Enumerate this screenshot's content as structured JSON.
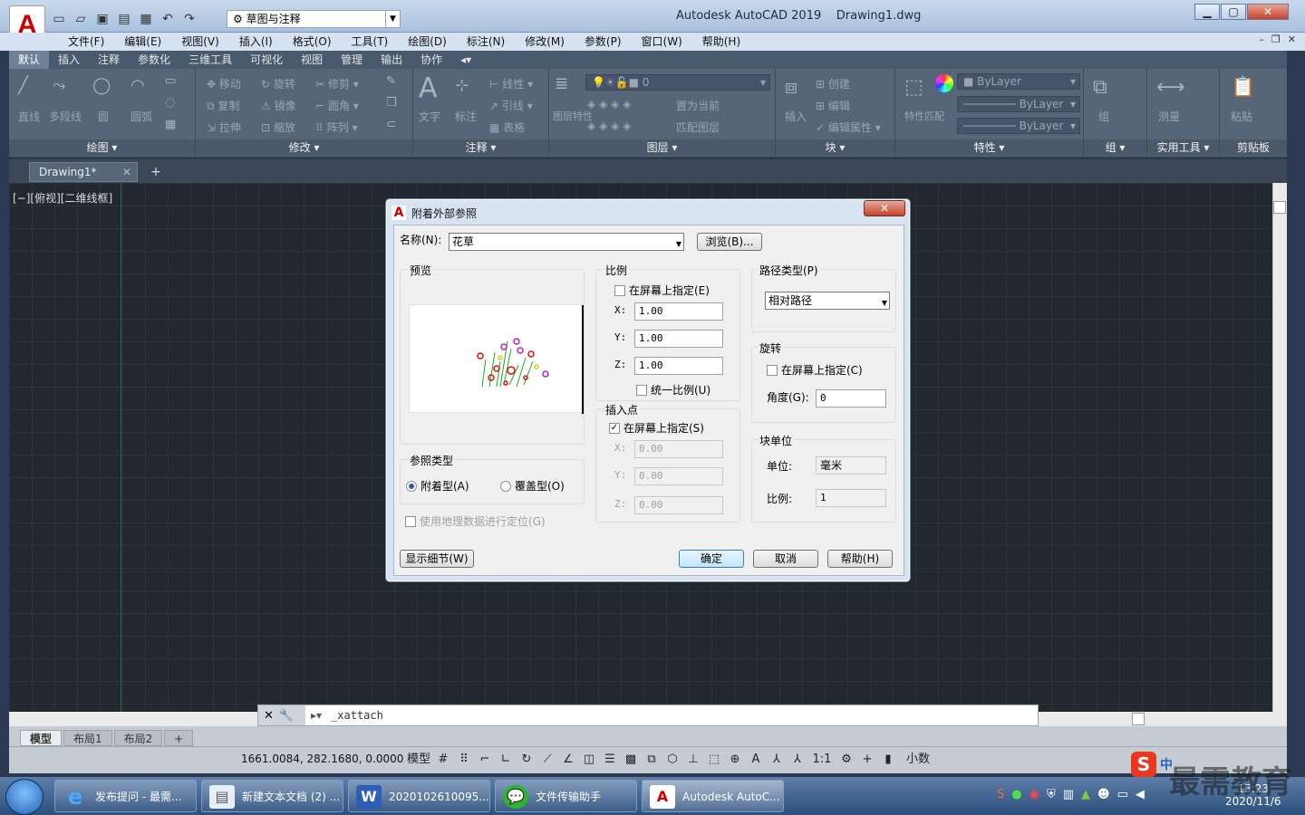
{
  "titlebar": {
    "workspace": "草图与注释",
    "window_title": "Autodesk AutoCAD 2019    Drawing1.dwg",
    "min": "▁",
    "max": "▢",
    "close": "✕"
  },
  "menu": [
    "文件(F)",
    "编辑(E)",
    "视图(V)",
    "插入(I)",
    "格式(O)",
    "工具(T)",
    "绘图(D)",
    "标注(N)",
    "修改(M)",
    "参数(P)",
    "窗口(W)",
    "帮助(H)"
  ],
  "ribbon": {
    "tabs": [
      "默认",
      "插入",
      "注释",
      "参数化",
      "三维工具",
      "可视化",
      "视图",
      "管理",
      "输出",
      "协作"
    ],
    "draw": {
      "title": "绘图",
      "tools": [
        "直线",
        "多段线",
        "圆",
        "圆弧"
      ]
    },
    "modify": {
      "title": "修改",
      "tools": [
        "移动",
        "旋转",
        "修剪",
        "复制",
        "镜像",
        "圆角",
        "拉伸",
        "缩放",
        "阵列"
      ]
    },
    "annotation": {
      "title": "注释",
      "tools": [
        "文字",
        "标注",
        "线性",
        "引线",
        "表格"
      ]
    },
    "layers": {
      "title": "图层",
      "layer_value": "0",
      "tools": [
        "图层特性",
        "置为当前",
        "匹配图层"
      ]
    },
    "block": {
      "title": "块",
      "tools": [
        "插入",
        "创建",
        "编辑",
        "编辑属性"
      ]
    },
    "properties": {
      "title": "特性",
      "tools": [
        "特性匹配"
      ],
      "color": "ByLayer",
      "linetype": "ByLayer",
      "lineweight": "ByLayer"
    },
    "groups": {
      "title": "组",
      "tools": [
        "组"
      ]
    },
    "utilities": {
      "title": "实用工具",
      "tools": [
        "测量"
      ]
    },
    "clipboard": {
      "title": "剪贴板",
      "tools": [
        "粘贴"
      ]
    }
  },
  "doc": {
    "tab": "Drawing1*",
    "close": "✕",
    "new": "+",
    "view_label": "[−][俯视][二维线框]"
  },
  "command": {
    "text": "_xattach"
  },
  "layout_tabs": [
    "模型",
    "布局1",
    "布局2",
    "+"
  ],
  "status": {
    "coords": "1661.0084, 282.1680, 0.0000",
    "model": "模型",
    "scale": "1:1",
    "units": "小数"
  },
  "dialog": {
    "title": "附着外部参照",
    "close": "✕",
    "name_label": "名称(N):",
    "name_value": "花草",
    "browse": "浏览(B)...",
    "preview_label": "预览",
    "scale": {
      "title": "比例",
      "on_screen": "在屏幕上指定(E)",
      "x_label": "X:",
      "y_label": "Y:",
      "z_label": "Z:",
      "x": "1.00",
      "y": "1.00",
      "z": "1.00",
      "uniform": "统一比例(U)"
    },
    "insert": {
      "title": "插入点",
      "on_screen": "在屏幕上指定(S)",
      "x_label": "X:",
      "y_label": "Y:",
      "z_label": "Z:",
      "x": "0.00",
      "y": "0.00",
      "z": "0.00"
    },
    "path": {
      "title": "路径类型(P)",
      "value": "相对路径"
    },
    "rotation": {
      "title": "旋转",
      "on_screen": "在屏幕上指定(C)",
      "angle_label": "角度(G):",
      "angle": "0"
    },
    "block_unit": {
      "title": "块单位",
      "unit_label": "单位:",
      "unit": "毫米",
      "factor_label": "比例:",
      "factor": "1"
    },
    "ref_type": {
      "title": "参照类型",
      "attach": "附着型(A)",
      "overlay": "覆盖型(O)"
    },
    "geo": "使用地理数据进行定位(G)",
    "details": "显示细节(W)",
    "ok": "确定",
    "cancel": "取消",
    "help": "帮助(H)"
  },
  "taskbar": {
    "items": [
      "发布提问 - 最需...",
      "新建文本文档 (2) ...",
      "2020102610095...",
      "文件传输助手",
      "Autodesk AutoC..."
    ],
    "time": "15:23",
    "date": "2020/11/6",
    "ime": "中"
  },
  "watermark": "最需教育"
}
